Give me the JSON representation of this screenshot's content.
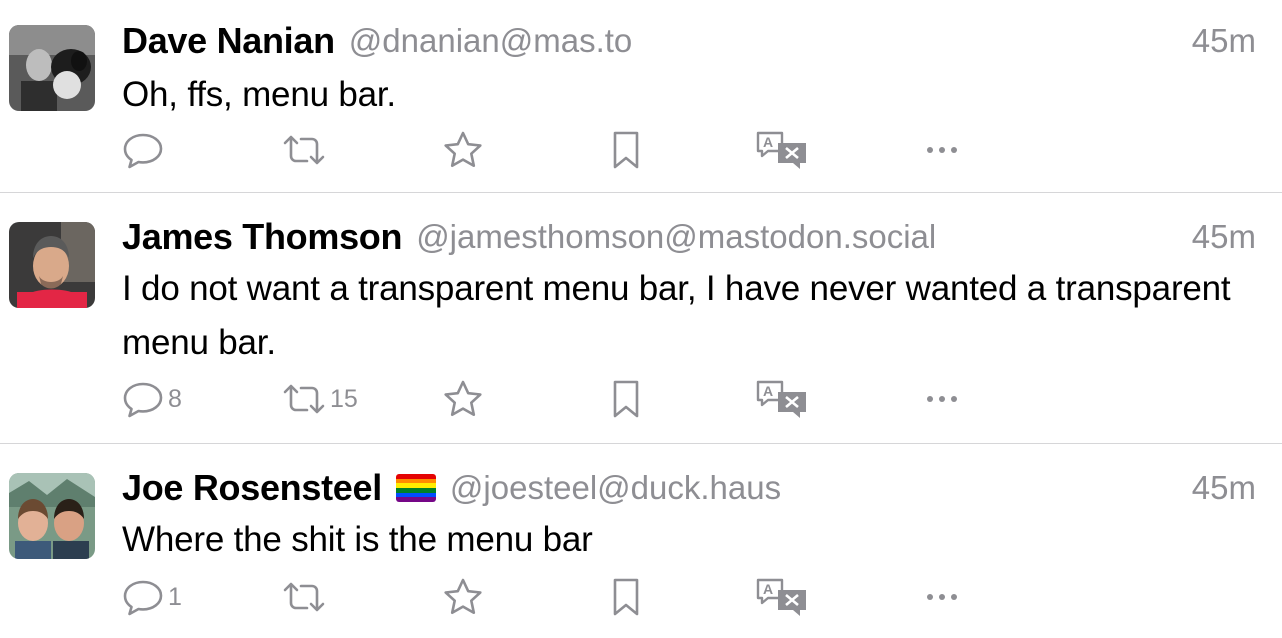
{
  "posts": [
    {
      "display_name": "Dave Nanian",
      "handle": "@dnanian@mas.to",
      "time": "45m",
      "content": "Oh, ffs, menu bar.",
      "reply_count": "",
      "boost_count": ""
    },
    {
      "display_name": "James Thomson",
      "handle": "@jamesthomson@mastodon.social",
      "time": "45m",
      "content": "I do not want a transparent menu bar, I have never wanted a transparent menu bar.",
      "reply_count": "8",
      "boost_count": "15"
    },
    {
      "display_name": "Joe Rosensteel",
      "handle": "@joesteel@duck.haus",
      "time": "45m",
      "content": "Where the shit is the menu bar",
      "reply_count": "1",
      "boost_count": ""
    }
  ],
  "icons": {
    "reply": "reply-icon",
    "boost": "boost-icon",
    "favorite": "star-icon",
    "bookmark": "bookmark-icon",
    "translate": "translate-icon",
    "more": "ellipsis-icon"
  },
  "colors": {
    "secondary_text": "#8e8e93",
    "divider": "#d6d6d8",
    "pride_flag": [
      "#e40303",
      "#ff8c00",
      "#ffed00",
      "#008026",
      "#004dff",
      "#750787"
    ]
  }
}
